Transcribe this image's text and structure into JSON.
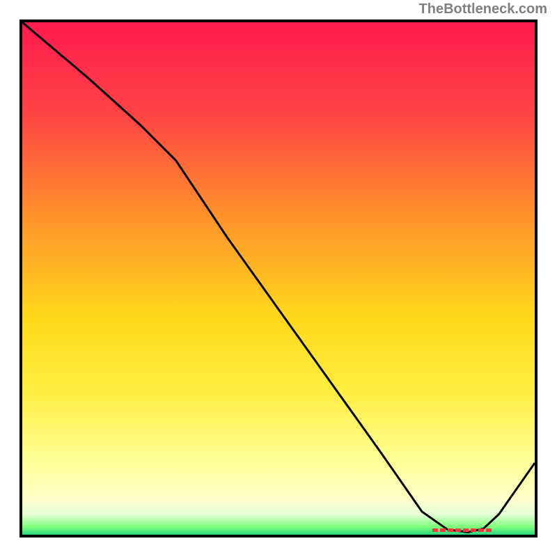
{
  "watermark": "TheBottleneck.com",
  "chart_data": {
    "type": "line",
    "title": "",
    "xlabel": "",
    "ylabel": "",
    "xlim": [
      0,
      100
    ],
    "ylim": [
      0,
      100
    ],
    "gradient_stops": [
      {
        "offset": 0.0,
        "color": "#ff1a4e"
      },
      {
        "offset": 0.18,
        "color": "#ff4444"
      },
      {
        "offset": 0.4,
        "color": "#ff9a28"
      },
      {
        "offset": 0.58,
        "color": "#ffd91a"
      },
      {
        "offset": 0.72,
        "color": "#ffee40"
      },
      {
        "offset": 0.86,
        "color": "#ffff99"
      },
      {
        "offset": 0.93,
        "color": "#ffffc8"
      },
      {
        "offset": 0.96,
        "color": "#e6ffd6"
      },
      {
        "offset": 0.985,
        "color": "#7bff7b"
      },
      {
        "offset": 1.0,
        "color": "#28d67e"
      }
    ],
    "series": [
      {
        "name": "curve",
        "color": "#000000",
        "x": [
          0,
          13,
          23,
          30,
          40,
          50,
          60,
          70,
          78,
          83,
          87,
          90,
          93,
          100
        ],
        "values": [
          100,
          89,
          80,
          73,
          58,
          44,
          30,
          16,
          4.5,
          1,
          0.5,
          1.2,
          4,
          14
        ]
      }
    ],
    "valley_marker": {
      "label": "",
      "color": "#fa363a",
      "x_start": 80,
      "x_end": 92,
      "y": 0.8
    }
  }
}
